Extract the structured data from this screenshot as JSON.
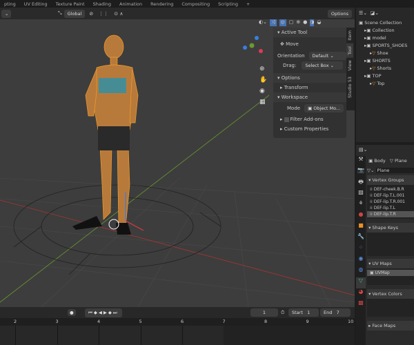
{
  "workspace_tabs": [
    "pting",
    "UV Editing",
    "Texture Paint",
    "Shading",
    "Animation",
    "Rendering",
    "Compositing",
    "Scripting",
    "+"
  ],
  "header": {
    "transform_orientation": "Global",
    "options_label": "Options"
  },
  "npanel": {
    "tabs": [
      "Item",
      "Tool",
      "View",
      "Studio 53"
    ],
    "active_tool_title": "Active Tool",
    "tool_name": "Move",
    "orientation_label": "Orientation",
    "orientation_value": "Default",
    "drag_label": "Drag:",
    "drag_value": "Select Box",
    "options_title": "Options",
    "transform_label": "Transform",
    "workspace_title": "Workspace",
    "mode_label": "Mode",
    "mode_value": "Object Mo...",
    "filter_addons": "Filter Add-ons",
    "custom_properties": "Custom Properties"
  },
  "outliner": {
    "items": [
      {
        "label": "Scene Collection",
        "indent": 0
      },
      {
        "label": "Collection",
        "indent": 1
      },
      {
        "label": "model",
        "indent": 1
      },
      {
        "label": "SPORTS_SHOES",
        "indent": 1
      },
      {
        "label": "Shoe",
        "indent": 2
      },
      {
        "label": "SHORTS",
        "indent": 1
      },
      {
        "label": "Shorts",
        "indent": 2
      },
      {
        "label": "TOP",
        "indent": 1
      },
      {
        "label": "Top",
        "indent": 2
      }
    ]
  },
  "properties": {
    "breadcrumb_object": "Body",
    "breadcrumb_mesh": "Plane",
    "mesh_name": "Plane",
    "vertex_groups_title": "Vertex Groups",
    "vertex_groups": [
      "DEF-cheek.B.R",
      "DEF-lip.T.L.001",
      "DEF-lip.T.R.001",
      "DEF-lip.T.L",
      "DEF-lip.T.R"
    ],
    "shape_keys_title": "Shape Keys",
    "uv_maps_title": "UV Maps",
    "uv_maps": [
      "UVMap"
    ],
    "vertex_colors_title": "Vertex Colors",
    "face_maps_title": "Face Maps"
  },
  "timeline": {
    "current_frame": "1",
    "start_label": "Start",
    "start": "1",
    "end_label": "End",
    "end": "7",
    "ruler": [
      "2",
      "3",
      "4",
      "5",
      "6",
      "7",
      "8",
      "9",
      "10"
    ]
  },
  "colors": {
    "accent": "#f29c2b",
    "selection": "#4772b3"
  }
}
